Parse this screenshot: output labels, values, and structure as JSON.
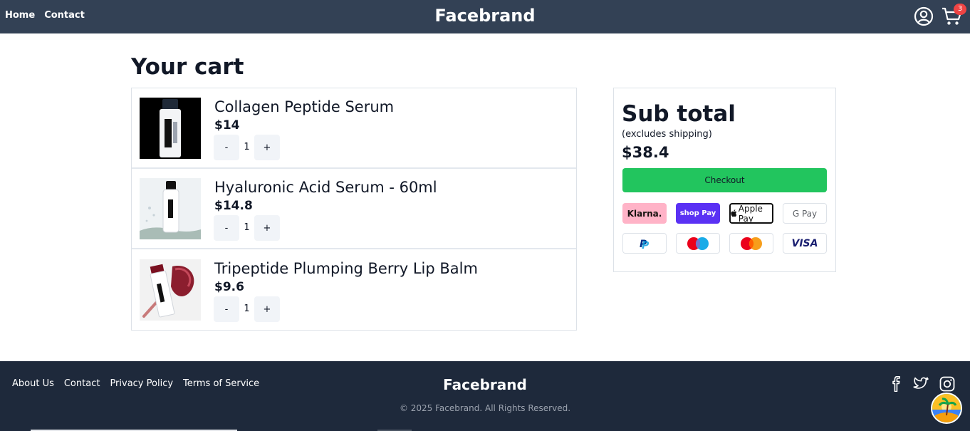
{
  "header": {
    "nav": [
      "Home",
      "Contact"
    ],
    "brand": "Facebrand",
    "cart_count": "3",
    "icons": [
      "user-circle-icon",
      "shopping-cart-icon"
    ]
  },
  "main": {
    "title": "Your cart",
    "items": [
      {
        "name": "Collagen Peptide Serum",
        "price": "$14",
        "qty": "1",
        "minus": "-",
        "plus": "+"
      },
      {
        "name": "Hyaluronic Acid Serum - 60ml",
        "price": "$14.8",
        "qty": "1",
        "minus": "-",
        "plus": "+"
      },
      {
        "name": "Tripeptide Plumping Berry Lip Balm",
        "price": "$9.6",
        "qty": "1",
        "minus": "-",
        "plus": "+"
      }
    ]
  },
  "summary": {
    "title": "Sub total",
    "note": "(excludes shipping)",
    "total": "$38.4",
    "checkout": "Checkout",
    "payment_methods": [
      "Klarna.",
      "shop Pay",
      "Apple Pay",
      "G Pay",
      "PayPal",
      "Maestro",
      "Mastercard",
      "VISA"
    ]
  },
  "footer": {
    "links": [
      "About Us",
      "Contact",
      "Privacy Policy",
      "Terms of Service"
    ],
    "brand": "Facebrand",
    "copyright": "© 2025 Facebrand. All Rights Reserved.",
    "social": [
      "facebook-icon",
      "twitter-icon",
      "instagram-icon"
    ]
  },
  "colors": {
    "header_bg": "#334155",
    "footer_bg": "#1e293b",
    "checkout": "#22c55e",
    "badge": "#ef4444"
  }
}
